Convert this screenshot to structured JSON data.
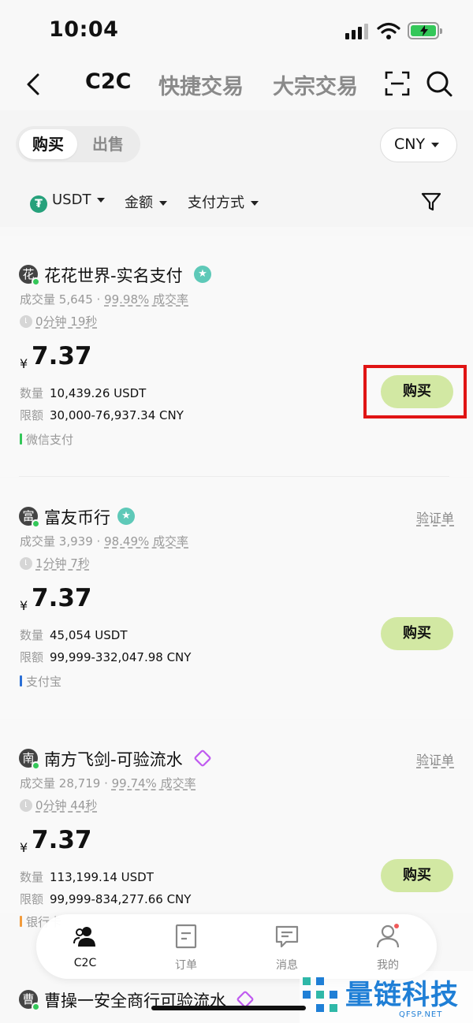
{
  "status_bar": {
    "time": "10:04"
  },
  "header": {
    "tabs": [
      {
        "label": "C2C",
        "active": true
      },
      {
        "label": "快捷交易",
        "active": false
      },
      {
        "label": "大宗交易",
        "active": false
      }
    ]
  },
  "trade_toggle": {
    "buy": "购买",
    "sell": "出售",
    "selected": "购买"
  },
  "currency": "CNY",
  "filters": {
    "asset": "USDT",
    "amount": "金额",
    "payment": "支付方式"
  },
  "listings": [
    {
      "merchant": "花花世界-实名支付",
      "avatar_char": "花",
      "badge": "star-badge",
      "volume_label": "成交量",
      "volume": "5,645",
      "completion": "99.98% 成交率",
      "time": "0分钟 19秒",
      "currency_symbol": "¥",
      "price": "7.37",
      "qty_label": "数量",
      "qty": "10,439.26 USDT",
      "limit_label": "限额",
      "limit": "30,000-76,937.34 CNY",
      "payment": "微信支付",
      "buy_label": "购买",
      "verify_label": ""
    },
    {
      "merchant": "富友币行",
      "avatar_char": "富",
      "badge": "star-badge",
      "volume_label": "成交量",
      "volume": "3,939",
      "completion": "98.49% 成交率",
      "time": "1分钟 7秒",
      "currency_symbol": "¥",
      "price": "7.37",
      "qty_label": "数量",
      "qty": "45,054 USDT",
      "limit_label": "限额",
      "limit": "99,999-332,047.98 CNY",
      "payment": "支付宝",
      "buy_label": "购买",
      "verify_label": "验证单"
    },
    {
      "merchant": "南方飞剑-可验流水",
      "avatar_char": "南",
      "badge": "gem-badge",
      "volume_label": "成交量",
      "volume": "28,719",
      "completion": "99.74% 成交率",
      "time": "0分钟 44秒",
      "currency_symbol": "¥",
      "price": "7.37",
      "qty_label": "数量",
      "qty": "113,199.14 USDT",
      "limit_label": "限额",
      "limit": "99,999-834,277.66 CNY",
      "payment": "银行卡",
      "buy_label": "购买",
      "verify_label": "验证单"
    },
    {
      "merchant": "曹操一安全商行可验流水",
      "avatar_char": "曹",
      "badge": "gem-badge"
    }
  ],
  "bottom_nav": [
    {
      "label": "C2C",
      "icon": "people-icon",
      "active": true
    },
    {
      "label": "订单",
      "icon": "order-icon",
      "active": false
    },
    {
      "label": "消息",
      "icon": "message-icon",
      "active": false
    },
    {
      "label": "我的",
      "icon": "profile-icon",
      "active": false
    }
  ],
  "watermark": {
    "title": "量链科技",
    "url": "QFSP.NET"
  },
  "colors": {
    "buy_button": "#d2e8a3",
    "accent_green": "#34c759",
    "highlight_box": "#e01414"
  }
}
